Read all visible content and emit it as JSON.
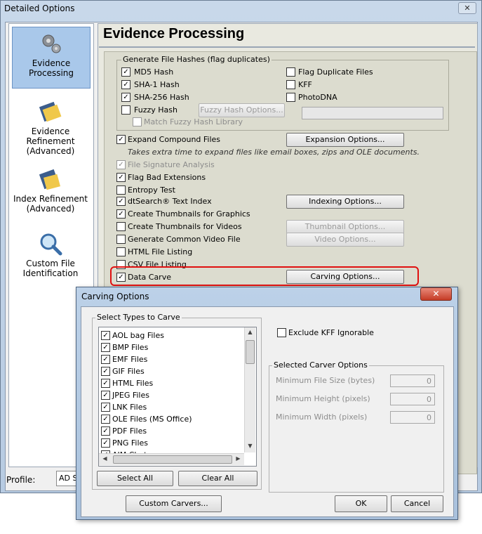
{
  "window": {
    "title": "Detailed Options",
    "close": "✕"
  },
  "nav": {
    "items": [
      {
        "label": "Evidence\nProcessing"
      },
      {
        "label": "Evidence\nRefinement\n(Advanced)"
      },
      {
        "label": "Index Refinement\n(Advanced)"
      },
      {
        "label": "Custom File\nIdentification"
      }
    ]
  },
  "main": {
    "title": "Evidence Processing",
    "hashes": {
      "group_label": "Generate File Hashes (flag duplicates)",
      "md5": "MD5 Hash",
      "sha1": "SHA-1 Hash",
      "sha256": "SHA-256 Hash",
      "fuzzy": "Fuzzy Hash",
      "fuzzy_options": "Fuzzy Hash Options...",
      "match_fuzzy": "Match Fuzzy Hash Library",
      "flag_dup": "Flag Duplicate Files",
      "kff": "KFF",
      "photodna": "PhotoDNA"
    },
    "options": {
      "expand_compound": "Expand Compound Files",
      "expansion_options": "Expansion Options...",
      "expand_note": "Takes extra time to expand files like email boxes, zips and OLE documents.",
      "file_signature": "File Signature Analysis",
      "flag_bad_ext": "Flag Bad Extensions",
      "entropy": "Entropy Test",
      "dtsearch": "dtSearch® Text Index",
      "indexing_options": "Indexing Options...",
      "thumbs_graphics": "Create Thumbnails for Graphics",
      "thumbs_videos": "Create Thumbnails for Videos",
      "thumbnail_options": "Thumbnail Options...",
      "common_video": "Generate Common Video File",
      "video_options": "Video Options...",
      "html_listing": "HTML File Listing",
      "csv_listing": "CSV File Listing",
      "data_carve": "Data Carve",
      "carving_options": "Carving Options..."
    },
    "check": "✓",
    "highlight_color": "#e01010"
  },
  "profile": {
    "label": "Profile:",
    "value": "AD S"
  },
  "dialog": {
    "title": "Carving Options",
    "close": "✕",
    "types_group": "Select Types to Carve",
    "types": [
      "AOL bag Files",
      "BMP Files",
      "EMF Files",
      "GIF Files",
      "HTML Files",
      "JPEG Files",
      "LNK Files",
      "OLE Files (MS Office)",
      "PDF Files",
      "PNG Files",
      "AIM Chat..."
    ],
    "select_all": "Select All",
    "clear_all": "Clear All",
    "exclude_kff": "Exclude KFF Ignorable",
    "selected_group": "Selected Carver Options",
    "min_size": "Minimum File Size (bytes)",
    "min_height": "Minimum Height (pixels)",
    "min_width": "Minimum Width (pixels)",
    "min_size_val": "0",
    "min_height_val": "0",
    "min_width_val": "0",
    "custom_carvers": "Custom Carvers...",
    "ok": "OK",
    "cancel": "Cancel",
    "scroll_up": "▲",
    "scroll_down": "▼",
    "scroll_left": "◀",
    "scroll_right": "▶"
  }
}
